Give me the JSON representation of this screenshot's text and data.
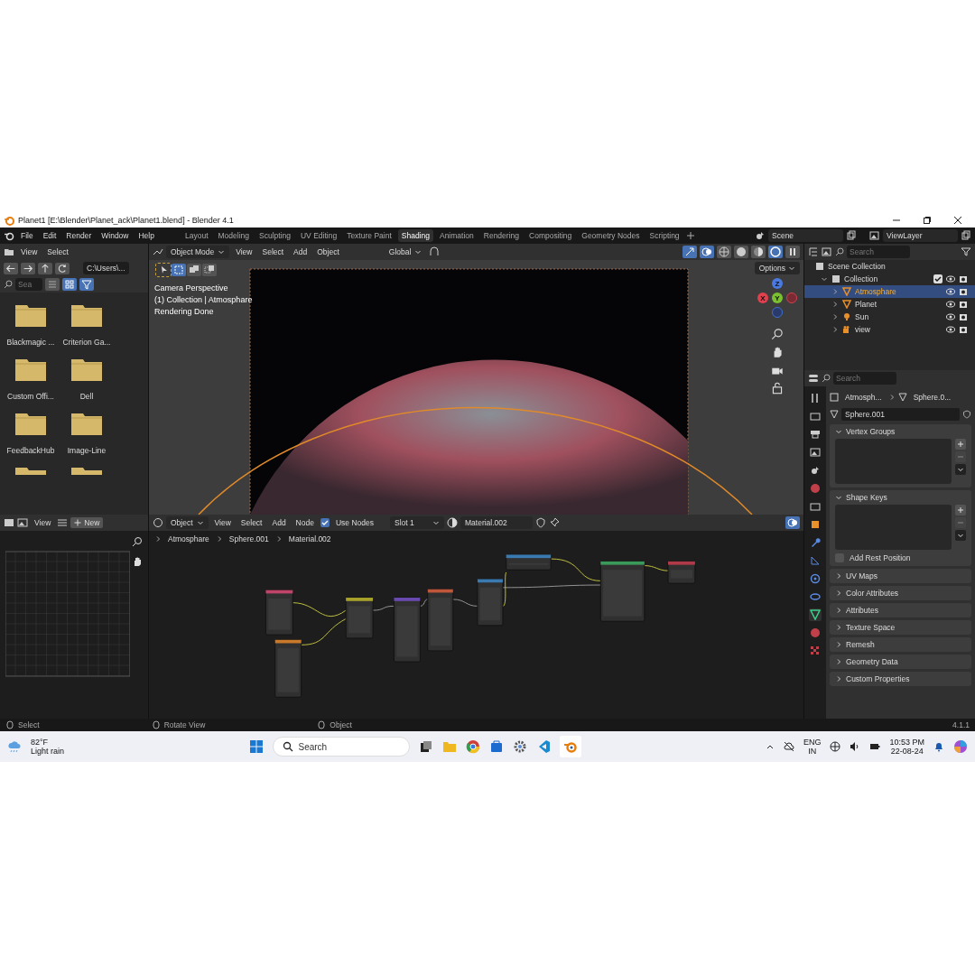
{
  "title_bar": {
    "title": "Planet1 [E:\\Blender\\Planet_ack\\Planet1.blend] - Blender 4.1"
  },
  "menu": [
    "File",
    "Edit",
    "Render",
    "Window",
    "Help"
  ],
  "workspaces": [
    {
      "label": "Layout",
      "selected": false
    },
    {
      "label": "Modeling",
      "selected": false
    },
    {
      "label": "Sculpting",
      "selected": false
    },
    {
      "label": "UV Editing",
      "selected": false
    },
    {
      "label": "Texture Paint",
      "selected": false
    },
    {
      "label": "Shading",
      "selected": true
    },
    {
      "label": "Animation",
      "selected": false
    },
    {
      "label": "Rendering",
      "selected": false
    },
    {
      "label": "Compositing",
      "selected": false
    },
    {
      "label": "Geometry Nodes",
      "selected": false
    },
    {
      "label": "Scripting",
      "selected": false
    }
  ],
  "scene": "Scene",
  "view_layer": "ViewLayer",
  "file_browser": {
    "menus": [
      "View",
      "Select"
    ],
    "path": "C:\\Users\\...",
    "search_placeholder": "Sea",
    "folders": [
      "Blackmagic ...",
      "Criterion Ga...",
      "Custom Offi...",
      "Dell",
      "FeedbackHub",
      "Image-Line"
    ]
  },
  "image_editor": {
    "menus": [
      "View"
    ],
    "new_button": "New"
  },
  "viewport": {
    "mode": "Object Mode",
    "menus": [
      "View",
      "Select",
      "Add",
      "Object"
    ],
    "transform": "Global",
    "options": "Options",
    "overlay_lines": [
      "Camera Perspective",
      "(1) Collection | Atmosphare",
      "Rendering Done"
    ],
    "axes": [
      "X",
      "Y",
      "Z"
    ]
  },
  "node_editor": {
    "mode": "Object",
    "menus": [
      "View",
      "Select",
      "Add",
      "Node"
    ],
    "use_nodes": {
      "label": "Use Nodes",
      "checked": true
    },
    "slot": "Slot 1",
    "material": "Material.002",
    "breadcrumbs": [
      "Atmosphare",
      "Sphere.001",
      "Material.002"
    ]
  },
  "outliner": {
    "search_placeholder": "Search",
    "root": "Scene Collection",
    "collection": {
      "label": "Collection",
      "checked": true,
      "expanded": true,
      "children": [
        {
          "label": "Atmosphare",
          "selected": true,
          "kind": "mesh"
        },
        {
          "label": "Planet",
          "selected": false,
          "kind": "mesh"
        },
        {
          "label": "Sun",
          "selected": false,
          "kind": "light"
        },
        {
          "label": "view",
          "selected": false,
          "kind": "camera"
        }
      ]
    }
  },
  "properties": {
    "search_placeholder": "Search",
    "breadcrumbs": [
      "Atmosph...",
      "Sphere.0..."
    ],
    "mesh_name": "Sphere.001",
    "panels": [
      {
        "label": "Vertex Groups",
        "expanded": true
      },
      {
        "label": "Shape Keys",
        "expanded": true,
        "option": {
          "label": "Add Rest Position",
          "checked": false
        }
      },
      {
        "label": "UV Maps",
        "expanded": false
      },
      {
        "label": "Color Attributes",
        "expanded": false
      },
      {
        "label": "Attributes",
        "expanded": false
      },
      {
        "label": "Texture Space",
        "expanded": false
      },
      {
        "label": "Remesh",
        "expanded": false
      },
      {
        "label": "Geometry Data",
        "expanded": false
      },
      {
        "label": "Custom Properties",
        "expanded": false
      }
    ]
  },
  "status_bar": {
    "items": [
      "Select",
      "Rotate View",
      "Object"
    ],
    "version": "4.1.1"
  },
  "taskbar": {
    "temperature": "82°F",
    "weather": "Light rain",
    "search_placeholder": "Search",
    "language": [
      "ENG",
      "IN"
    ],
    "time": "10:53 PM",
    "date": "22-08-24"
  }
}
